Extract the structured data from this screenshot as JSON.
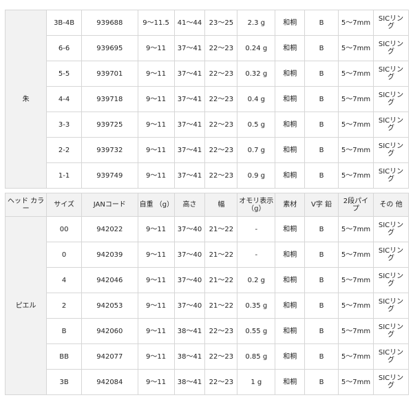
{
  "header": [
    "ヘッド カラー",
    "サイズ",
    "JANコード",
    "自重 （g）",
    "高さ",
    "幅",
    "オモリ表示（g）",
    "素材",
    "V字 鉛",
    "2段パイプ",
    "その 他"
  ],
  "groups": [
    {
      "color": "朱",
      "rows": [
        [
          "3B-4B",
          "939688",
          "9〜11.5",
          "41〜44",
          "23〜25",
          "2.3 g",
          "和桐",
          "B",
          "5〜7mm",
          "SICリング"
        ],
        [
          "6-6",
          "939695",
          "9〜11",
          "37〜41",
          "22〜23",
          "0.24 g",
          "和桐",
          "B",
          "5〜7mm",
          "SICリング"
        ],
        [
          "5-5",
          "939701",
          "9〜11",
          "37〜41",
          "22〜23",
          "0.32 g",
          "和桐",
          "B",
          "5〜7mm",
          "SICリング"
        ],
        [
          "4-4",
          "939718",
          "9〜11",
          "37〜41",
          "22〜23",
          "0.4 g",
          "和桐",
          "B",
          "5〜7mm",
          "SICリング"
        ],
        [
          "3-3",
          "939725",
          "9〜11",
          "37〜41",
          "22〜23",
          "0.5 g",
          "和桐",
          "B",
          "5〜7mm",
          "SICリング"
        ],
        [
          "2-2",
          "939732",
          "9〜11",
          "37〜41",
          "22〜23",
          "0.7 g",
          "和桐",
          "B",
          "5〜7mm",
          "SICリング"
        ],
        [
          "1-1",
          "939749",
          "9〜11",
          "37〜41",
          "22〜23",
          "0.9 g",
          "和桐",
          "B",
          "5〜7mm",
          "SICリング"
        ]
      ]
    },
    {
      "color": "ピエル",
      "rows": [
        [
          "00",
          "942022",
          "9〜11",
          "37〜40",
          "21〜22",
          "-",
          "和桐",
          "B",
          "5〜7mm",
          "SICリング"
        ],
        [
          "0",
          "942039",
          "9〜11",
          "37〜40",
          "21〜22",
          "-",
          "和桐",
          "B",
          "5〜7mm",
          "SICリング"
        ],
        [
          "4",
          "942046",
          "9〜11",
          "37〜40",
          "21〜22",
          "0.2 g",
          "和桐",
          "B",
          "5〜7mm",
          "SICリング"
        ],
        [
          "2",
          "942053",
          "9〜11",
          "37〜40",
          "21〜22",
          "0.35 g",
          "和桐",
          "B",
          "5〜7mm",
          "SICリング"
        ],
        [
          "B",
          "942060",
          "9〜11",
          "38〜41",
          "22〜23",
          "0.55 g",
          "和桐",
          "B",
          "5〜7mm",
          "SICリング"
        ],
        [
          "BB",
          "942077",
          "9〜11",
          "38〜41",
          "22〜23",
          "0.85 g",
          "和桐",
          "B",
          "5〜7mm",
          "SICリング"
        ],
        [
          "3B",
          "942084",
          "9〜11",
          "38〜41",
          "22〜23",
          "1 g",
          "和桐",
          "B",
          "5〜7mm",
          "SICリング"
        ]
      ]
    }
  ]
}
